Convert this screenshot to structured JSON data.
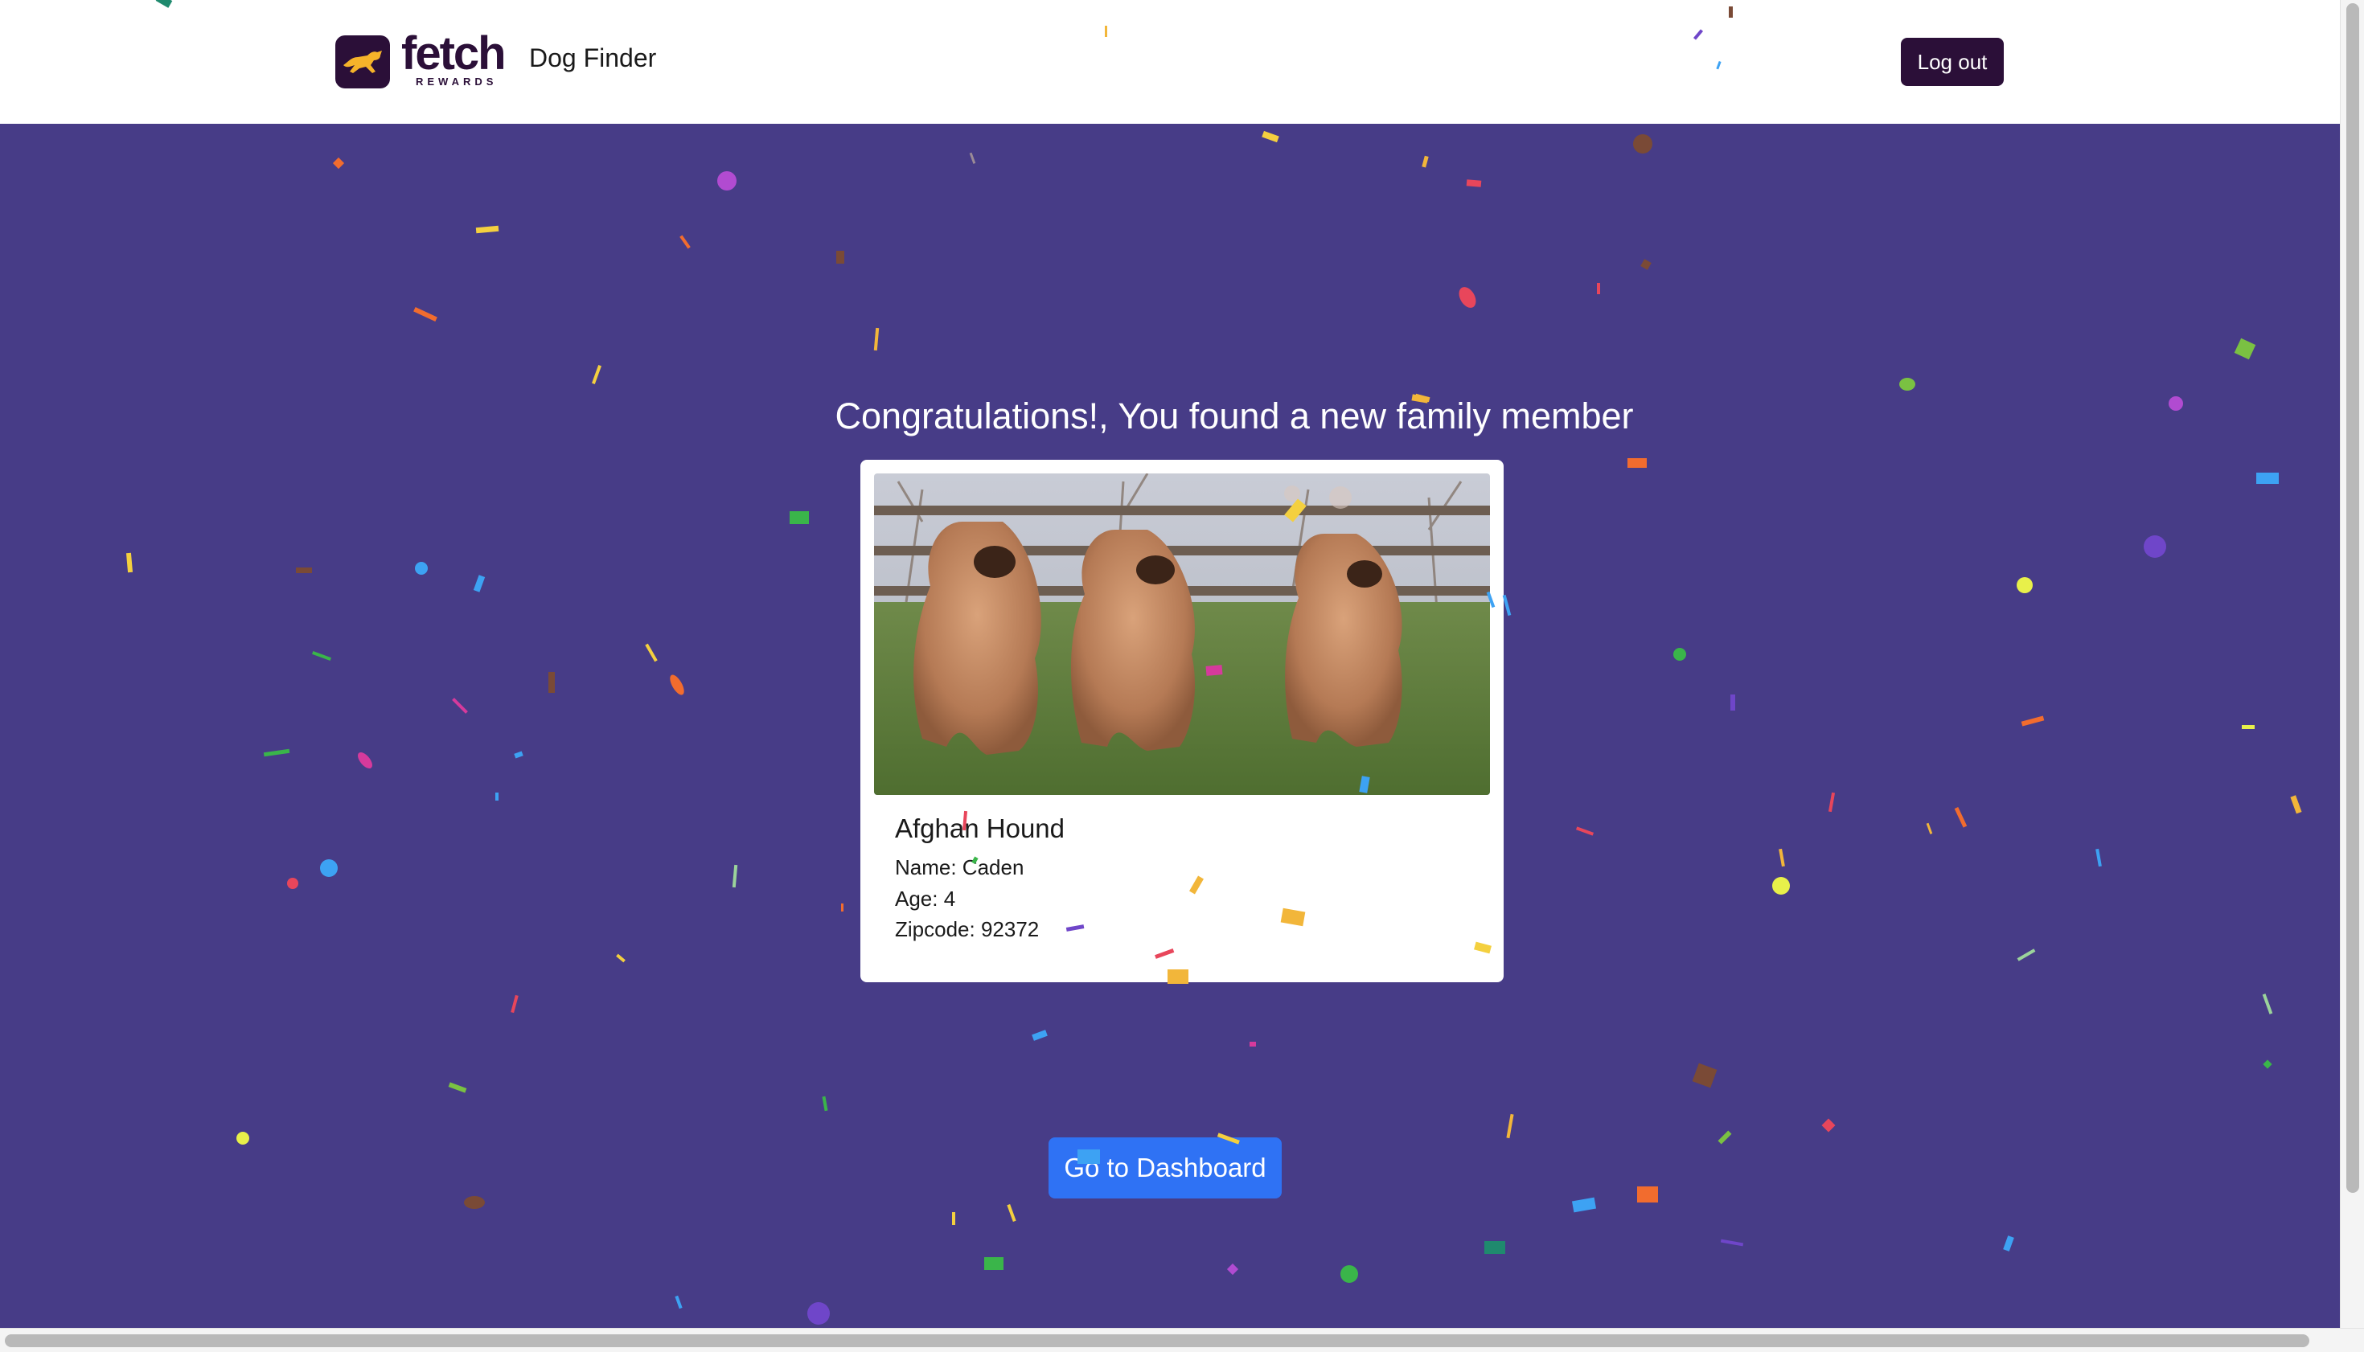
{
  "header": {
    "logo_word": "fetch",
    "logo_sub": "REWARDS",
    "app_title": "Dog Finder",
    "logout_label": "Log out"
  },
  "main": {
    "headline": "Congratulations!, You found a new family member",
    "card": {
      "breed": "Afghan Hound",
      "name_line": "Name: Caden",
      "age_line": "Age: 4",
      "zip_line": "Zipcode: 92372"
    },
    "dashboard_label": "Go to Dashboard"
  },
  "colors": {
    "brand": "#2b0f38",
    "background": "#473c87",
    "primary_button": "#2f72f4"
  },
  "icons": {
    "logo": "running-dog-icon"
  }
}
